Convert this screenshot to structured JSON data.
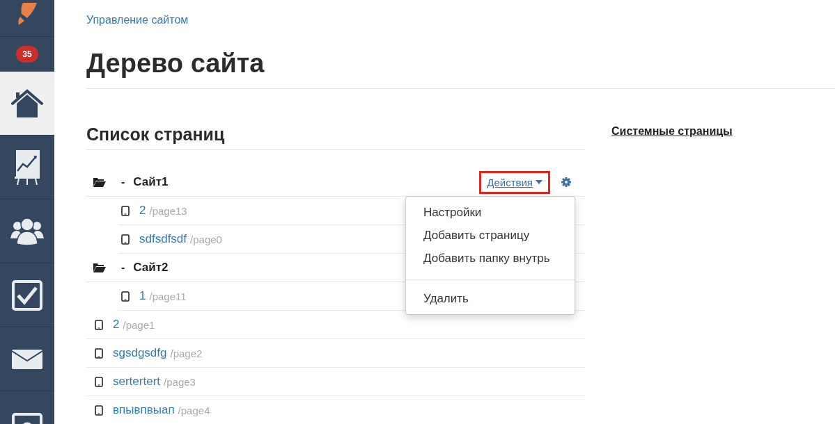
{
  "sidebar": {
    "items": [
      {
        "kind": "rocket",
        "selected": false
      },
      {
        "kind": "badge",
        "badge": "35",
        "selected": false
      },
      {
        "kind": "home",
        "selected": true
      },
      {
        "kind": "chart",
        "selected": false
      },
      {
        "kind": "users",
        "selected": false
      },
      {
        "kind": "tasks",
        "selected": false
      },
      {
        "kind": "mail",
        "selected": false
      },
      {
        "kind": "settings",
        "selected": false
      }
    ]
  },
  "breadcrumb": "Управление сайтом",
  "title": "Дерево сайта",
  "pages_list": {
    "heading": "Список страниц",
    "tree": [
      {
        "kind": "folder",
        "name": "Сайт1",
        "dash": "-",
        "actions": {
          "label": "Действия",
          "highlighted": true,
          "expanded": true,
          "menu": [
            {
              "kind": "item",
              "label": "Настройки"
            },
            {
              "kind": "item",
              "label": "Добавить страницу"
            },
            {
              "kind": "item",
              "label": "Добавить папку внутрь"
            },
            {
              "kind": "divider"
            },
            {
              "kind": "item",
              "label": "Удалить"
            }
          ]
        },
        "children": [
          {
            "kind": "page",
            "name": "2",
            "path": "/page13"
          },
          {
            "kind": "page",
            "name": "sdfsdfsdf",
            "path": "/page0"
          }
        ]
      },
      {
        "kind": "folder",
        "name": "Сайт2",
        "dash": "-",
        "children": [
          {
            "kind": "page",
            "name": "1",
            "path": "/page11"
          }
        ]
      },
      {
        "kind": "page",
        "name": "2",
        "path": "/page1"
      },
      {
        "kind": "page",
        "name": "sgsdgsdfg",
        "path": "/page2"
      },
      {
        "kind": "page",
        "name": "sertertert",
        "path": "/page3"
      },
      {
        "kind": "page",
        "name": "впывпвыап",
        "path": "/page4"
      }
    ]
  },
  "system_pages_link": "Системные страницы"
}
